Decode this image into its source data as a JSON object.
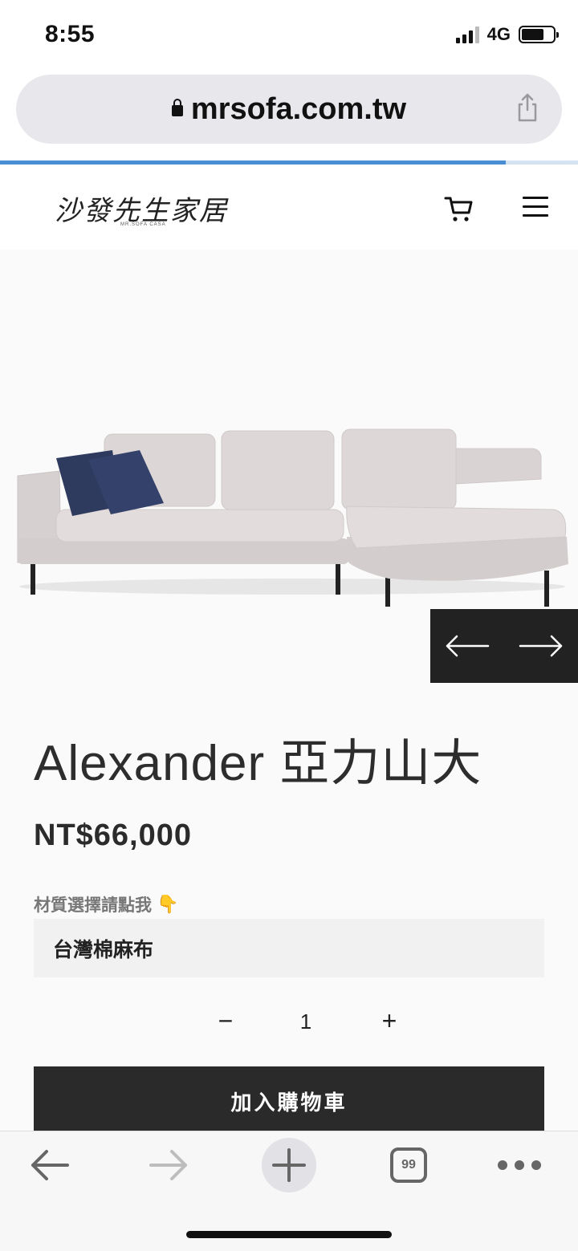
{
  "status": {
    "time": "8:55",
    "network": "4G",
    "battery_level": 0.7
  },
  "browser": {
    "url": "mrsofa.com.tw",
    "load_progress": 0.875
  },
  "header": {
    "logo_text": "沙發先生家居",
    "logo_subtext": "MR.SOFA CASA"
  },
  "product": {
    "title": "Alexander 亞力山大",
    "price": "NT$66,000",
    "option_label": "材質選擇請點我",
    "option_value": "台灣棉麻布",
    "quantity": "1",
    "add_to_cart_label": "加入購物車"
  },
  "controls": {
    "minus_label": "−",
    "plus_label": "+"
  },
  "bottom_bar": {
    "tab_count": "99"
  },
  "icons": {
    "lock": "lock-icon",
    "share": "share-icon",
    "cart": "cart-icon",
    "menu": "menu-icon",
    "prev": "arrow-left-icon",
    "next": "arrow-right-icon",
    "pointing": "pointing-down-icon"
  },
  "colors": {
    "accent_progress": "#4a8fd4",
    "button_dark": "#2a2a2a",
    "pillow": "#2e3a5e",
    "sofa_fabric": "#ddd7d7"
  }
}
